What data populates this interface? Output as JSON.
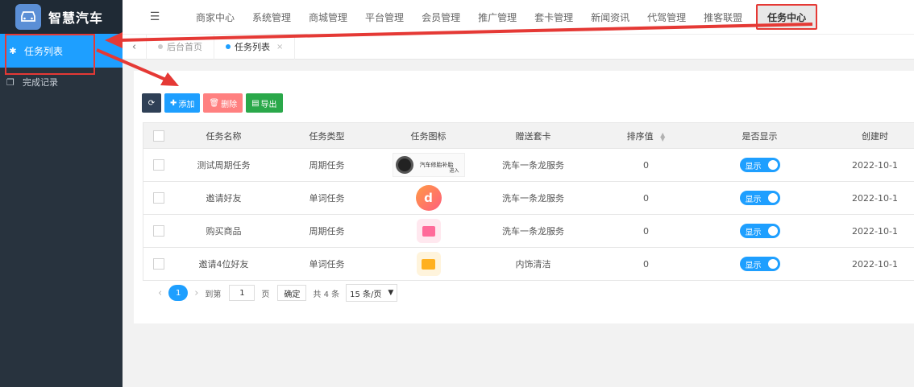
{
  "app": {
    "title": "智慧汽车"
  },
  "sidebar": {
    "items": [
      {
        "label": "任务列表",
        "icon": "gear-icon",
        "active": true
      },
      {
        "label": "完成记录",
        "icon": "copy-icon",
        "active": false
      }
    ]
  },
  "topnav": {
    "items": [
      "商家中心",
      "系统管理",
      "商城管理",
      "平台管理",
      "会员管理",
      "推广管理",
      "套卡管理",
      "新闻资讯",
      "代驾管理",
      "推客联盟"
    ],
    "active": "任务中心"
  },
  "tabs": {
    "items": [
      {
        "label": "后台首页",
        "active": false
      },
      {
        "label": "任务列表",
        "active": true,
        "close": "×"
      }
    ]
  },
  "toolbar": {
    "add": "添加",
    "delete": "删除",
    "export": "导出"
  },
  "table": {
    "headers": [
      "任务名称",
      "任务类型",
      "任务图标",
      "赠送套卡",
      "排序值",
      "是否显示",
      "创建时"
    ],
    "rows": [
      {
        "name": "测试周期任务",
        "type": "周期任务",
        "icon": "tire-banner-image",
        "card": "洗车一条龙服务",
        "sort": "0",
        "show": "显示",
        "created": "2022-10-1"
      },
      {
        "name": "邀请好友",
        "type": "单词任务",
        "icon": "d-logo-icon",
        "card": "洗车一条龙服务",
        "sort": "0",
        "show": "显示",
        "created": "2022-10-1"
      },
      {
        "name": "购买商品",
        "type": "周期任务",
        "icon": "shopping-bag-icon",
        "card": "洗车一条龙服务",
        "sort": "0",
        "show": "显示",
        "created": "2022-10-1"
      },
      {
        "name": "邀请4位好友",
        "type": "单词任务",
        "icon": "envelope-icon",
        "card": "内饰清洁",
        "sort": "0",
        "show": "显示",
        "created": "2022-10-1"
      }
    ],
    "banner_text": "汽车修胎补胎",
    "banner_sub": "进入"
  },
  "pager": {
    "current": "1",
    "goto_label": "到第",
    "goto_value": "1",
    "page_unit": "页",
    "confirm": "确定",
    "total": "共 4 条",
    "page_size": "15 条/页"
  },
  "colors": {
    "accent": "#1e9fff",
    "sidebar": "#28333e",
    "highlight": "#e53935"
  }
}
